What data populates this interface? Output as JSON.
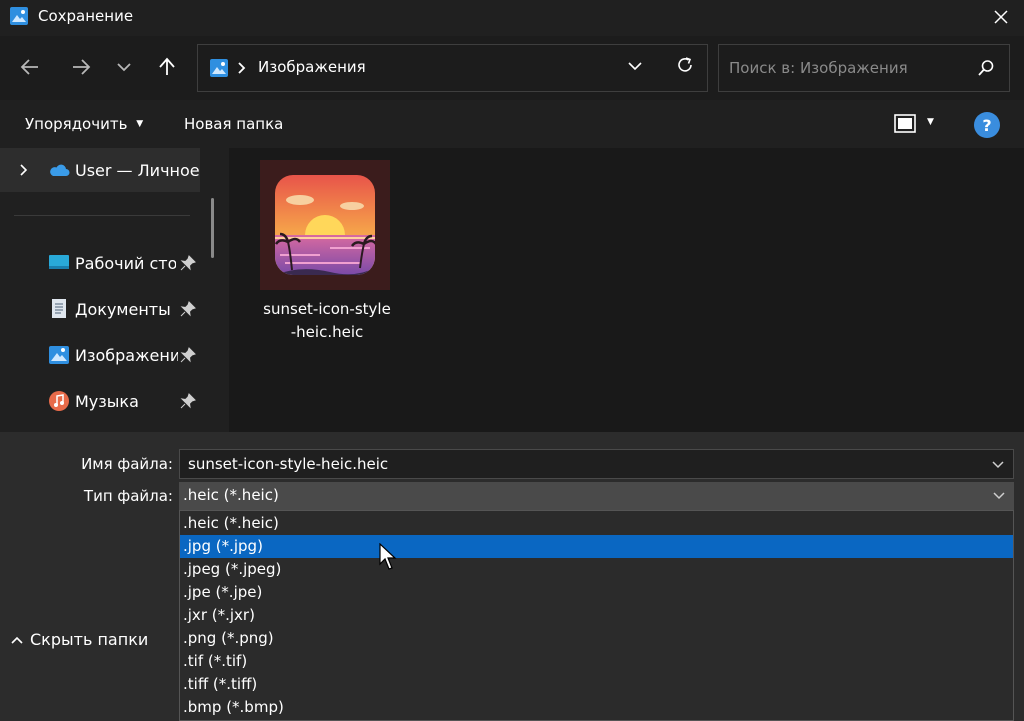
{
  "window": {
    "title": "Сохранение"
  },
  "navigation": {
    "back_icon": "arrow-left-icon",
    "forward_icon": "arrow-right-icon",
    "recent_icon": "chevron-down-icon",
    "up_icon": "arrow-up-icon"
  },
  "address": {
    "location": "Изображения",
    "icon": "pictures-folder-icon"
  },
  "search": {
    "placeholder": "Поиск в: Изображения"
  },
  "commands": {
    "organize": "Упорядочить",
    "new_folder": "Новая папка",
    "help": "?"
  },
  "sidebar": {
    "items": [
      {
        "label": "User — Личное",
        "icon": "onedrive-cloud-icon"
      },
      {
        "label": "Рабочий стол",
        "icon": "desktop-icon",
        "pinned": true
      },
      {
        "label": "Документы",
        "icon": "documents-icon",
        "pinned": true
      },
      {
        "label": "Изображения",
        "icon": "pictures-icon",
        "pinned": true
      },
      {
        "label": "Музыка",
        "icon": "music-icon",
        "pinned": true
      }
    ]
  },
  "files": [
    {
      "name_line1": "sunset-icon-style",
      "name_line2": "-heic.heic"
    }
  ],
  "form": {
    "filename_label": "Имя файла:",
    "filename_value": "sunset-icon-style-heic.heic",
    "filetype_label": "Тип файла:",
    "filetype_value": ".heic (*.heic)",
    "filetype_options": [
      ".heic (*.heic)",
      ".jpg (*.jpg)",
      ".jpeg (*.jpeg)",
      ".jpe (*.jpe)",
      ".jxr (*.jxr)",
      ".png (*.png)",
      ".tif (*.tif)",
      ".tiff (*.tiff)",
      ".bmp (*.bmp)"
    ],
    "highlighted_option": ".jpg (*.jpg)",
    "hide_folders": "Скрыть папки"
  },
  "colors": {
    "accent": "#0a67c2",
    "help": "#3a8dde"
  }
}
